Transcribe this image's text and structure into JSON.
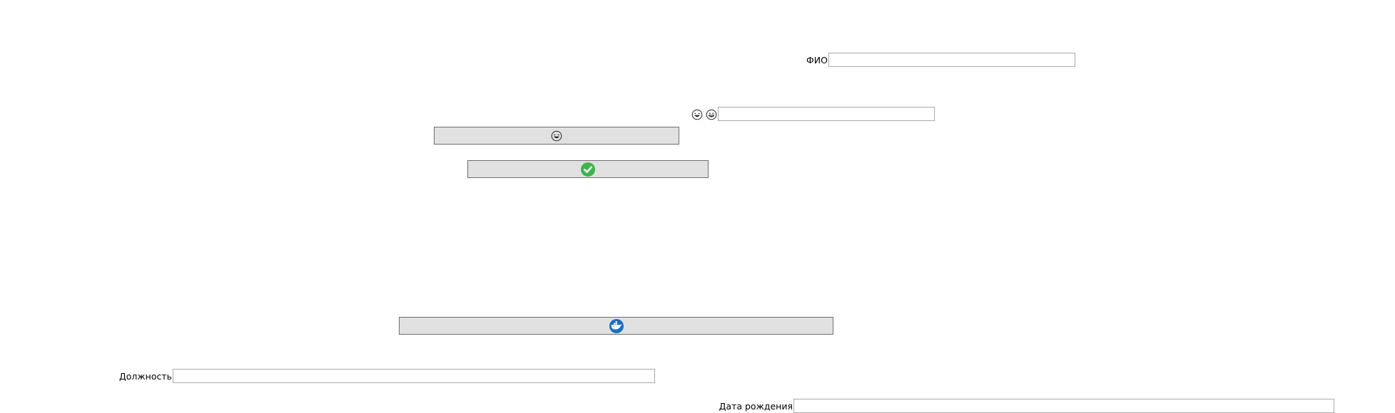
{
  "form": {
    "fio": {
      "label": "ФИО",
      "value": ""
    },
    "emoji_field": {
      "value": ""
    },
    "position": {
      "label": "Должность",
      "value": ""
    },
    "birth_date": {
      "label": "Дата рождения",
      "value": ""
    }
  },
  "buttons": {
    "emoji_button": {
      "icon": "grinning-face-icon"
    },
    "confirm_button": {
      "icon": "green-checkmark-icon",
      "color": "#3cb54a"
    },
    "docker_button": {
      "icon": "docker-whale-icon",
      "color": "#1a6fc4"
    }
  },
  "icons": {
    "emoji_prefix": [
      "laughing-face-icon",
      "grinning-face-icon"
    ]
  }
}
